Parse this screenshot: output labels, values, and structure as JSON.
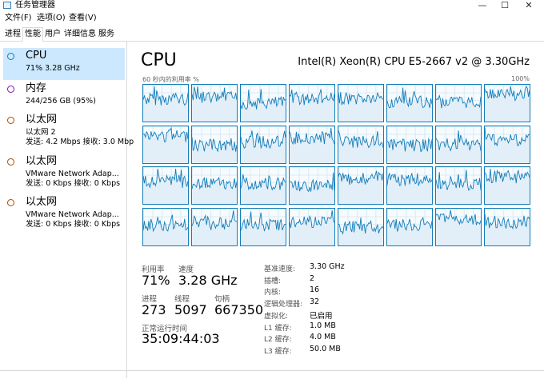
{
  "window": {
    "title": "任务管理器",
    "controls": {
      "minimize": "—",
      "maximize": "☐",
      "close": "✕"
    }
  },
  "menu": [
    "文件(F)",
    "选项(O)",
    "查看(V)"
  ],
  "tabs": [
    "进程",
    "性能",
    "用户",
    "详细信息",
    "服务"
  ],
  "active_tab": "性能",
  "sidebar": [
    {
      "title": "CPU",
      "line1": "71% 3.28 GHz",
      "line2": "",
      "selected": true,
      "color": "#117dbb"
    },
    {
      "title": "内存",
      "line1": "244/256 GB (95%)",
      "line2": "",
      "selected": false,
      "color": "#8b12ae"
    },
    {
      "title": "以太网",
      "line1": "以太网 2",
      "line2": "发送: 4.2 Mbps 接收: 3.0 Mbp",
      "selected": false,
      "color": "#a74f01"
    },
    {
      "title": "以太网",
      "line1": "VMware Network Adap...",
      "line2": "发送: 0 Kbps 接收: 0 Kbps",
      "selected": false,
      "color": "#a74f01"
    },
    {
      "title": "以太网",
      "line1": "VMware Network Adap...",
      "line2": "发送: 0 Kbps 接收: 0 Kbps",
      "selected": false,
      "color": "#a74f01"
    }
  ],
  "main": {
    "title": "CPU",
    "cpu_model": "Intel(R) Xeon(R) CPU E5-2667 v2 @ 3.30GHz",
    "graph_label": "60 秒内的利用率 %",
    "graph_max": "100%",
    "core_count": 32,
    "stats": {
      "utilization_label": "利用率",
      "utilization": "71%",
      "speed_label": "速度",
      "speed": "3.28 GHz",
      "processes_label": "进程",
      "processes": "273",
      "threads_label": "线程",
      "threads": "5097",
      "handles_label": "句柄",
      "handles": "667350",
      "uptime_label": "正常运行时间",
      "uptime": "35:09:44:03"
    },
    "specs": [
      {
        "label": "基准速度:",
        "value": "3.30 GHz"
      },
      {
        "label": "插槽:",
        "value": "2"
      },
      {
        "label": "内核:",
        "value": "16"
      },
      {
        "label": "逻辑处理器:",
        "value": "32"
      },
      {
        "label": "虚拟化:",
        "value": "已启用"
      },
      {
        "label": "L1 缓存:",
        "value": "1.0 MB"
      },
      {
        "label": "L2 缓存:",
        "value": "4.0 MB"
      },
      {
        "label": "L3 缓存:",
        "value": "50.0 MB"
      }
    ]
  },
  "colors": {
    "accent": "#117dbb",
    "selected_bg": "#cce8ff",
    "graph_fill": "#f1f6fa"
  }
}
